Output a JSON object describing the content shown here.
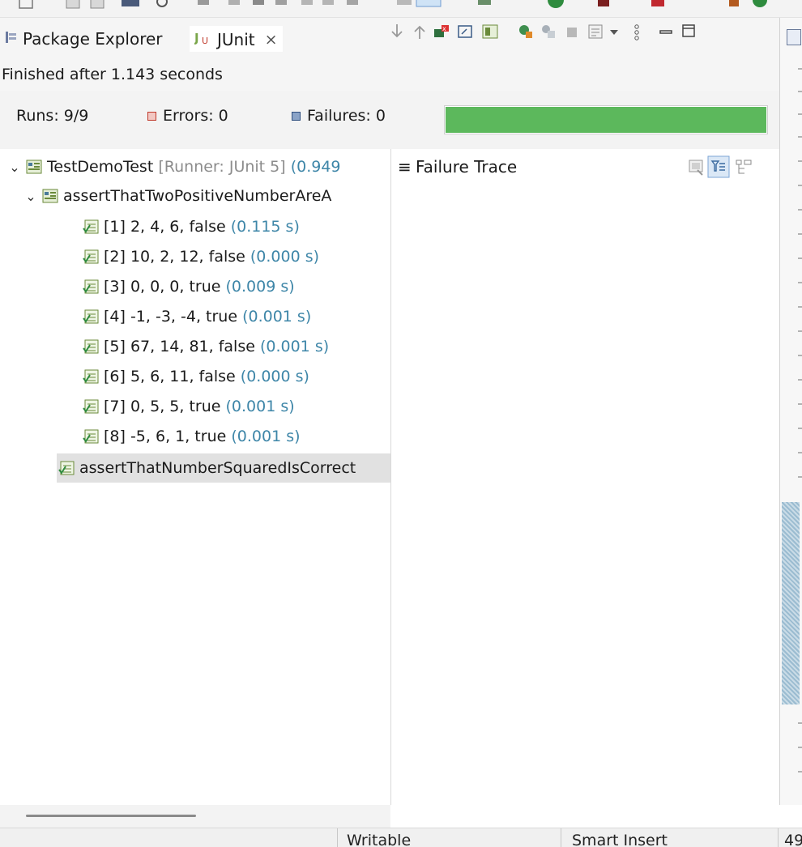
{
  "tabs": {
    "package_explorer": "Package Explorer",
    "junit": "JUnit",
    "close_glyph": "×"
  },
  "status_line": "Finished after 1.143 seconds",
  "counters": {
    "runs_label": "Runs:",
    "runs_value": "9/9",
    "errors_label": "Errors:",
    "errors_value": "0",
    "failures_label": "Failures:",
    "failures_value": "0",
    "progress": 1.0,
    "progress_color": "#5cb85c"
  },
  "tree": {
    "root": {
      "name": "TestDemoTest",
      "runner": "[Runner: JUnit 5]",
      "time": "(0.949"
    },
    "method1": {
      "name": "assertThatTwoPositiveNumberAreA"
    },
    "cases": [
      {
        "label": "[1] 2, 4, 6, false",
        "time": "(0.115 s)"
      },
      {
        "label": "[2] 10, 2, 12, false",
        "time": "(0.000 s)"
      },
      {
        "label": "[3] 0, 0, 0, true",
        "time": "(0.009 s)"
      },
      {
        "label": "[4] -1, -3, -4, true",
        "time": "(0.001 s)"
      },
      {
        "label": "[5] 67, 14, 81, false",
        "time": "(0.001 s)"
      },
      {
        "label": "[6] 5, 6, 11, false",
        "time": "(0.000 s)"
      },
      {
        "label": "[7] 0, 5, 5, true",
        "time": "(0.001 s)"
      },
      {
        "label": "[8] -5, 6, 1, true",
        "time": "(0.001 s)"
      }
    ],
    "method2": {
      "name": "assertThatNumberSquaredIsCorrect"
    }
  },
  "trace": {
    "title": "Failure Trace"
  },
  "status_bar": {
    "writable": "Writable",
    "insert_mode": "Smart Insert",
    "position": "49"
  },
  "colors": {
    "time_text": "#3e86a8",
    "runner_text": "#8c8c8c",
    "selection": "#e1e1e1"
  }
}
